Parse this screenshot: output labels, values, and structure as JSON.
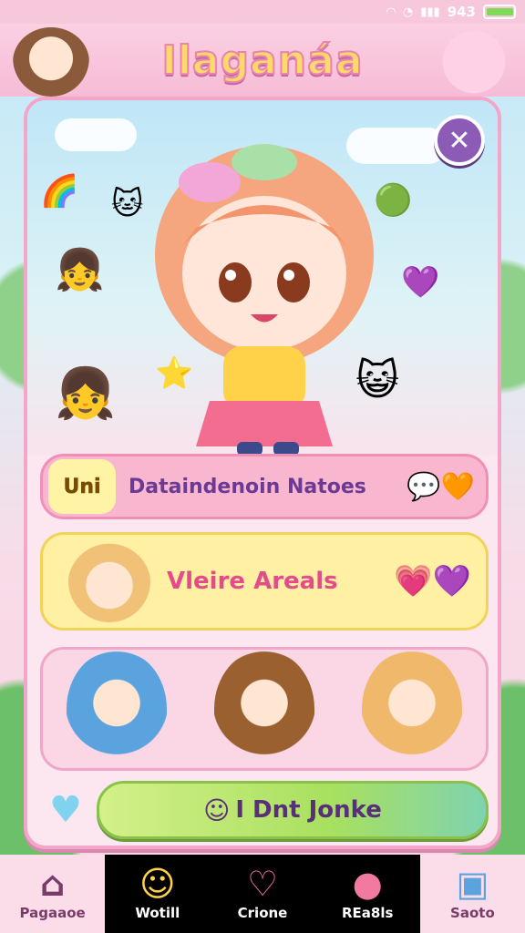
{
  "status_bar": {
    "time": "943",
    "icons": [
      "wifi-icon",
      "alarm-icon",
      "signal-icon",
      "battery-icon"
    ],
    "battery_level": 0.9
  },
  "header": {
    "title": "Ilaganáa"
  },
  "main_card": {
    "close_label": "✕",
    "info_row": {
      "tag": "Uni",
      "text": "Dataindenoin Natoes"
    },
    "areas_row": {
      "text": "Vleire Areals"
    },
    "action_button": {
      "label": "I Dnt Jonke"
    }
  },
  "bottom_nav": {
    "items": [
      {
        "label": "Pagaaoe",
        "icon": "house-icon",
        "glyph": "⌂"
      },
      {
        "label": "Wotill",
        "icon": "smiley-icon",
        "glyph": "☺"
      },
      {
        "label": "Crione",
        "icon": "heart-icon",
        "glyph": "♡"
      },
      {
        "label": "REa8ls",
        "icon": "blob-icon",
        "glyph": "●"
      },
      {
        "label": "Saoto",
        "icon": "chest-icon",
        "glyph": "▣"
      }
    ]
  },
  "colors": {
    "accent": "#f3a6c8",
    "title_fill": "#ffd96a",
    "close_button": "#8b5bb5",
    "action_green": "#a8e05f"
  }
}
